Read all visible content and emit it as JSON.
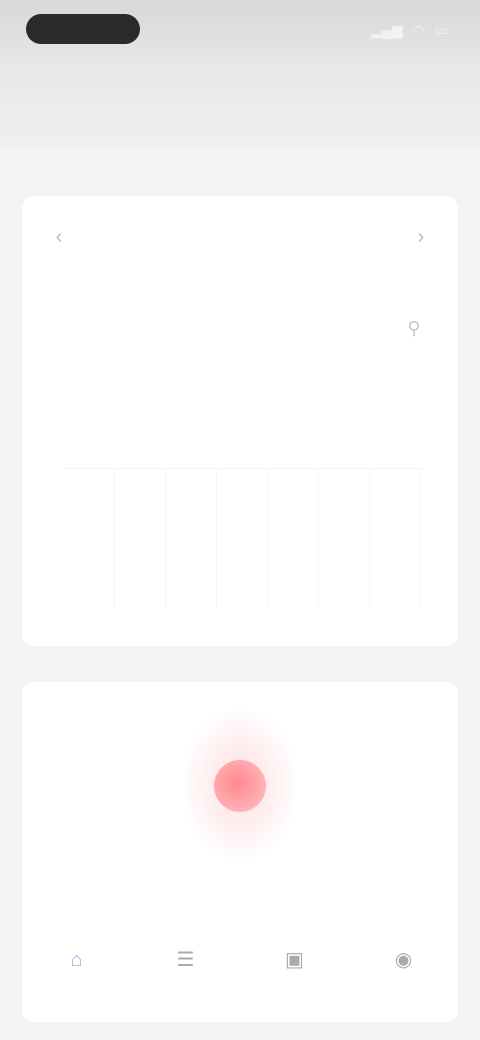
{
  "status_bar": {
    "time": "",
    "icons": [
      "signal-icon",
      "wifi-icon",
      "battery-icon"
    ]
  },
  "header": {
    "title": ""
  },
  "calendar": {
    "month_label": "",
    "subtitle": "",
    "prev_icon": "chevron-left-icon",
    "next_icon": "chevron-right-icon",
    "tools_icon": "sliders-icon",
    "weekdays": [
      "",
      "",
      "",
      "",
      "",
      "",
      ""
    ],
    "days": [
      "",
      "",
      "",
      "",
      "",
      "",
      "",
      "",
      "",
      "",
      ""
    ],
    "note": ""
  },
  "record": {
    "icon": "record-dot-icon",
    "accent_color": "#ff8a8f",
    "caption": ""
  },
  "tabs": [
    {
      "icon": "home-icon",
      "label": "",
      "active": true,
      "color": "#b7a3e8"
    },
    {
      "icon": "list-icon",
      "label": "",
      "active": false
    },
    {
      "icon": "chat-icon",
      "label": "",
      "active": false
    },
    {
      "icon": "profile-icon",
      "label": "",
      "active": false
    }
  ]
}
